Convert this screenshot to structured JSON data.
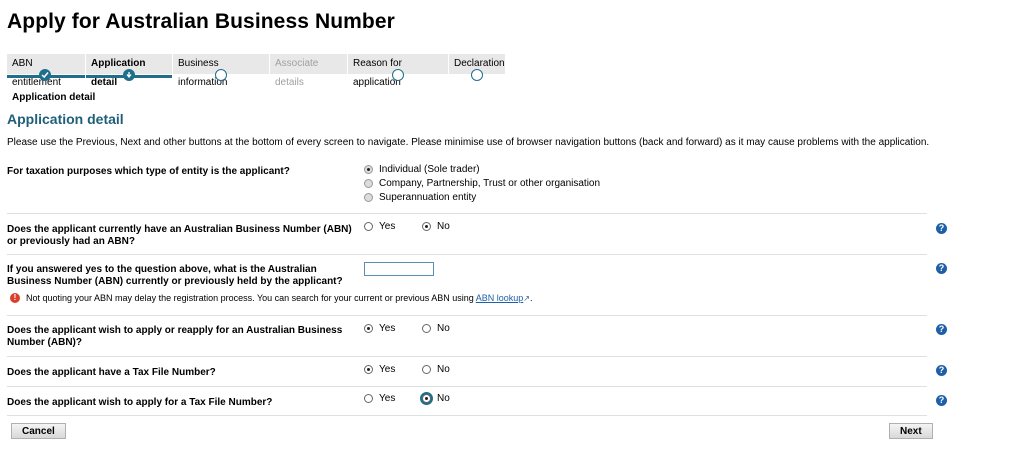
{
  "page": {
    "title": "Apply for Australian Business Number",
    "breadcrumb": "Application detail"
  },
  "stepper": {
    "steps": [
      {
        "label": "ABN entitlement",
        "state": "done"
      },
      {
        "label": "Application detail",
        "state": "current"
      },
      {
        "label": "Business information",
        "state": "todo"
      },
      {
        "label": "Associate details",
        "state": "disabled"
      },
      {
        "label": "Reason for application",
        "state": "todo"
      },
      {
        "label": "Declaration",
        "state": "todo"
      }
    ]
  },
  "section": {
    "heading": "Application detail",
    "intro": "Please use the Previous, Next and other buttons at the bottom of every screen to navigate. Please minimise use of browser navigation buttons (back and forward) as it may cause problems with the application."
  },
  "questions": {
    "entity": {
      "text": "For taxation purposes which type of entity is the applicant?",
      "options": [
        "Individual (Sole trader)",
        "Company, Partnership, Trust or other organisation",
        "Superannuation entity"
      ],
      "selected": "Individual (Sole trader)"
    },
    "has_abn": {
      "text": "Does the applicant currently have an Australian Business Number (ABN) or previously had an ABN?",
      "yes": "Yes",
      "no": "No",
      "selected": "No"
    },
    "abn_number": {
      "text": "If you answered yes to the question above, what is the Australian Business Number (ABN) currently or previously held by the applicant?",
      "value": "",
      "warning": "Not quoting your ABN may delay the registration process. You can search for your current or previous ABN using",
      "link": "ABN lookup",
      "link_suffix": "."
    },
    "apply_abn": {
      "text": "Does the applicant wish to apply or reapply for an Australian Business Number (ABN)?",
      "yes": "Yes",
      "no": "No",
      "selected": "Yes"
    },
    "has_tfn": {
      "text": "Does the applicant have a Tax File Number?",
      "yes": "Yes",
      "no": "No",
      "selected": "Yes"
    },
    "apply_tfn": {
      "text": "Does the applicant wish to apply for a Tax File Number?",
      "yes": "Yes",
      "no": "No",
      "selected": "No"
    }
  },
  "buttons": {
    "cancel": "Cancel",
    "next": "Next"
  },
  "icons": {
    "help": "help-icon",
    "warning": "warning-icon",
    "external_link": "external-link-icon"
  },
  "colors": {
    "accent": "#1f6e8c",
    "heading": "#1f5f7a",
    "help": "#1f5fa8",
    "warning": "#d9402b"
  }
}
